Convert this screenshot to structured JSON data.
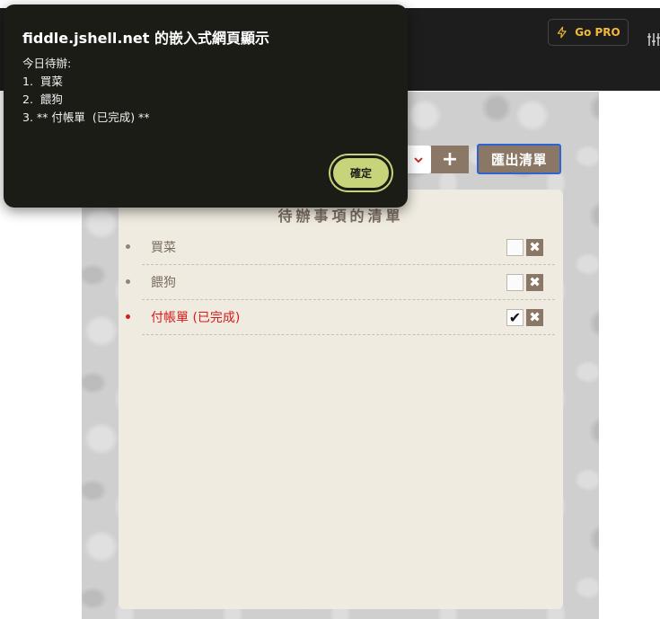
{
  "header": {
    "go_pro_label": "Go PRO",
    "accent_color": "#f2b93b"
  },
  "app": {
    "add_button_label": "+",
    "export_button_label": "匯出清單",
    "list_title": "待辦事項的清單",
    "items": [
      {
        "label": "買菜",
        "checked": false,
        "done": false,
        "check_mark": "",
        "delete_icon": "✖"
      },
      {
        "label": "餵狗",
        "checked": false,
        "done": false,
        "check_mark": "",
        "delete_icon": "✖"
      },
      {
        "label": "付帳單 (已完成)",
        "checked": true,
        "done": true,
        "check_mark": "✔",
        "delete_icon": "✖"
      }
    ],
    "done_color": "#d81a1a"
  },
  "dialog": {
    "title": "fiddle.jshell.net 的嵌入式網頁顯示",
    "lines": [
      "今日待辦:",
      "1.  買菜",
      "2.  餵狗",
      "3. ** 付帳單  (已完成) **"
    ],
    "ok_label": "確定"
  }
}
